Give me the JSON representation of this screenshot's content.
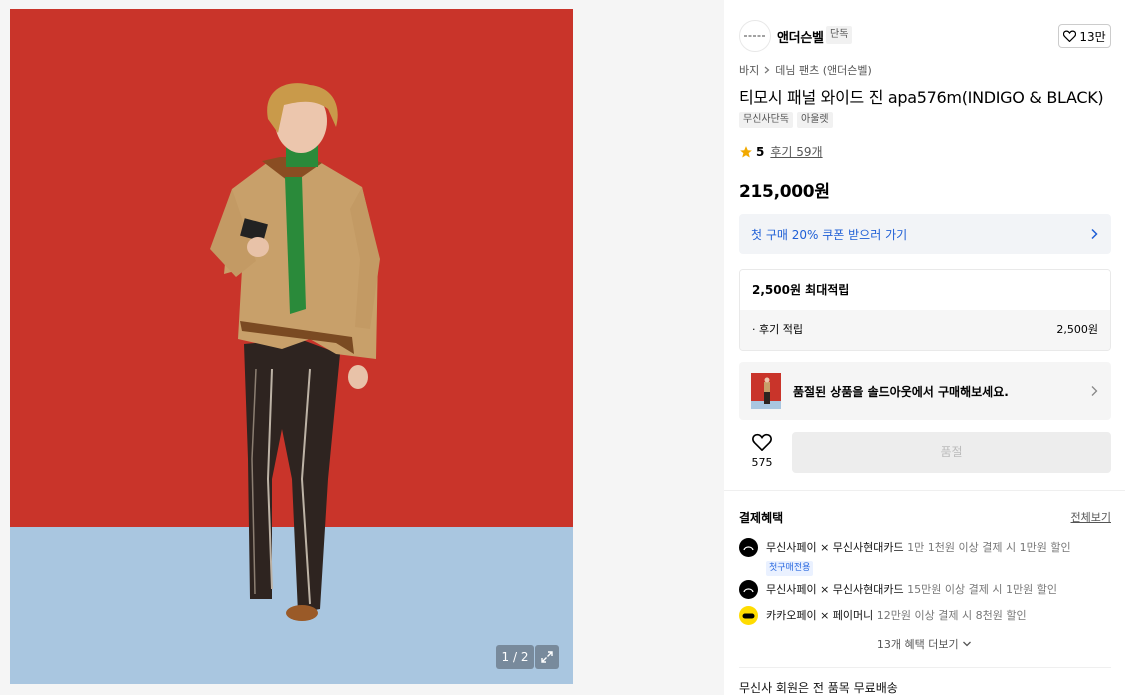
{
  "gallery": {
    "counter": "1 / 2"
  },
  "brand": {
    "name": "앤더슨벨",
    "badge": "단독",
    "likes": "13만"
  },
  "breadcrumb": {
    "items": [
      "바지",
      "데님 팬츠 (앤더슨벨)"
    ]
  },
  "product": {
    "title": "티모시 패널 와이드 진 apa576m(INDIGO & BLACK)",
    "tags": [
      "무신사단독",
      "아울렛"
    ],
    "rating": "5",
    "reviews": "후기 59개",
    "price": "215,000원"
  },
  "coupon": {
    "text": "첫 구매 20% 쿠폰 받으러 가기"
  },
  "points": {
    "title": "2,500원 최대적립",
    "row_label": "· 후기 적립",
    "row_value": "2,500원"
  },
  "soldout": {
    "banner_text": "품절된 상품을 솔드아웃에서 구매해보세요.",
    "button_label": "품절"
  },
  "wish": {
    "count": "575"
  },
  "benefits": {
    "title": "결제혜택",
    "view_all": "전체보기",
    "items": [
      {
        "name": "무신사페이 × 무신사현대카드",
        "desc": "1만 1천원 이상 결제 시 1만원 할인",
        "badge": "첫구매전용"
      },
      {
        "name": "무신사페이 × 무신사현대카드",
        "desc": "15만원 이상 결제 시 1만원 할인"
      },
      {
        "name": "카카오페이 × 페이머니",
        "desc": "12만원 이상 결제 시 8천원 할인"
      }
    ],
    "more": "13개 혜택 더보기"
  },
  "shipping": {
    "text": "무신사 회원은 전 품목 무료배송"
  },
  "colors": {
    "accent_blue": "#1f5fd6",
    "backdrop_red": "#c9342a",
    "floor_blue": "#a9c6e0"
  }
}
